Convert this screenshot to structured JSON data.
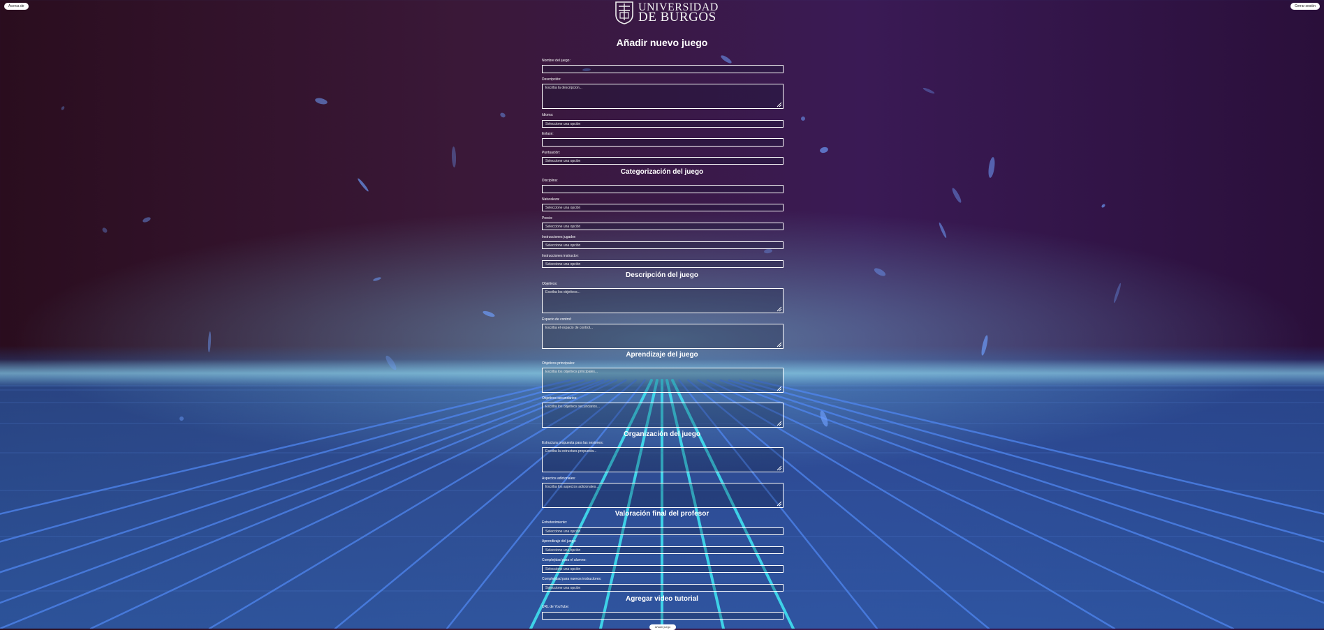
{
  "header": {
    "left_button": "Acerca de",
    "right_button": "Cerrar sesión",
    "logo_line1": "UNIVERSIDAD",
    "logo_line2": "DE BURGOS"
  },
  "page_title": "Añadir nuevo juego",
  "icons": {
    "logo": "university-crest-icon",
    "resize": "resize-handle-icon"
  },
  "colors": {
    "accent_line": "#40e0f0",
    "lower_glow": "#3c64b4",
    "field_border": "#ffffff"
  },
  "placeholders": {
    "select": "Seleccione una opción",
    "descripcion": "Escriba la descripcion...",
    "objetivos": "Escriba los objetivos...",
    "espacio": "Escriba el espacio de control...",
    "obj_principales": "Escriba los objetivos principales...",
    "obj_secundarios": "Escriba los objetivos secundarios...",
    "estructura": "Escriba la estructura propuesta...",
    "aspectos": "Escriba los aspectos adicionales..."
  },
  "sections": {
    "categorizacion": "Categorización del juego",
    "descripcion": "Descripción del juego",
    "aprendizaje": "Aprendizaje del juego",
    "organizacion": "Organización del juego",
    "valoracion": "Valoración final del profesor",
    "video": "Agregar video tutorial"
  },
  "labels": {
    "nombre": "Nombre del juego:",
    "descripcion": "Descripción:",
    "idioma": "Idioma:",
    "enlace": "Enlace:",
    "puntuacion": "Puntuación:",
    "disciplina": "Disciplina:",
    "naturaleza": "Naturaleza:",
    "precio": "Precio:",
    "instr_jugador": "Instrucciones jugador:",
    "instr_instructor": "Instrucciones instructor:",
    "objetivos": "Objetivos:",
    "espacio": "Espacio de control:",
    "obj_principales": "Objetivos principales:",
    "obj_secundarios": "Objetivos secundarios:",
    "estructura": "Estructura propuesta para las sesiones:",
    "aspectos": "Aspectos adicionales:",
    "entretenimiento": "Entretenimiento:",
    "aprendizaje": "Aprendizaje del juego:",
    "complejidad_alumno": "Complejidad para el alumno:",
    "complejidad_instructores": "Complejidad para nuevos instructores:",
    "url_youtube": "URL de YouTube:"
  },
  "submit_label": "Añadir juego"
}
